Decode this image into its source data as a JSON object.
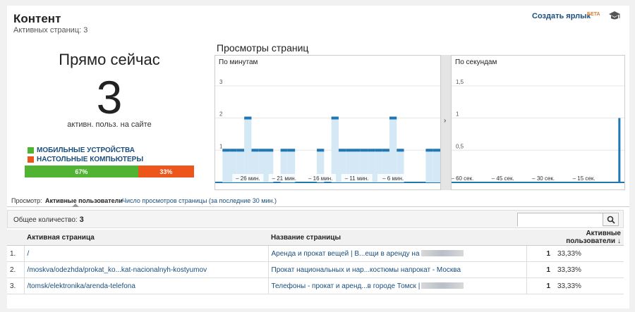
{
  "header": {
    "title": "Контент",
    "subtitle": "Активных страниц: 3",
    "shortcut_label": "Создать ярлык",
    "beta_label": "БЕТА"
  },
  "now": {
    "title": "Прямо сейчас",
    "count": "3",
    "subtitle": "активн. польз. на сайте",
    "legend": [
      {
        "label": "МОБИЛЬНЫЕ УСТРОЙСТВА",
        "color": "#50b432"
      },
      {
        "label": "НАСТОЛЬНЫЕ КОМПЬЮТЕРЫ",
        "color": "#ed561b"
      }
    ],
    "split": [
      {
        "label": "67%",
        "fraction": 0.67,
        "color": "#50b432"
      },
      {
        "label": "33%",
        "fraction": 0.33,
        "color": "#ed561b"
      }
    ]
  },
  "views": {
    "title": "Просмотры страниц",
    "minutes_label": "По минутам",
    "seconds_label": "По секундам",
    "collapse_icon": "chevron-right-icon"
  },
  "chart_data": [
    {
      "type": "bar",
      "title": "По минутам",
      "yticks": [
        1,
        2,
        3
      ],
      "ylim": [
        0,
        3.5
      ],
      "xtick_labels": [
        "– 26 мин.",
        "– 21 мин.",
        "– 16 мин.",
        "– 11 мин.",
        "– 6 мин."
      ],
      "x": [
        -30,
        -29,
        -28,
        -27,
        -26,
        -25,
        -24,
        -23,
        -22,
        -21,
        -20,
        -19,
        -18,
        -17,
        -16,
        -15,
        -14,
        -13,
        -12,
        -11,
        -10,
        -9,
        -8,
        -7,
        -6,
        -5,
        -4,
        -3,
        -2,
        -1,
        0
      ],
      "values": [
        0,
        1,
        1,
        1,
        2,
        1,
        1,
        1,
        0,
        1,
        1,
        0,
        0,
        0,
        1,
        0,
        2,
        1,
        1,
        1,
        1,
        1,
        1,
        1,
        2,
        1,
        0,
        0,
        0,
        1,
        1
      ],
      "grid": true
    },
    {
      "type": "bar",
      "title": "По секундам",
      "yticks": [
        0.5,
        1,
        1.5
      ],
      "ylim": [
        0,
        1.75
      ],
      "xtick_labels": [
        "– 60 сек.",
        "– 45 сек.",
        "– 30 сек.",
        "– 15 сек."
      ],
      "x": [
        -2
      ],
      "values": [
        1
      ],
      "grid": true
    }
  ],
  "tabs": {
    "view_label": "Просмотр:",
    "active": "Активные пользователи",
    "other": "Число просмотров страницы (за последние 30 мин.)"
  },
  "total": {
    "label": "Общее количество:",
    "value": "3",
    "search_placeholder": ""
  },
  "table": {
    "headers": {
      "page": "Активная страница",
      "title": "Название страницы",
      "users": "Активные пользователи"
    },
    "rows": [
      {
        "idx": "1.",
        "page": "/",
        "title": "Аренда и прокат вещей | В...ещи в аренду на",
        "count": "1",
        "pct": "33,33%"
      },
      {
        "idx": "2.",
        "page": "/moskva/odezhda/prokat_ko...kat-nacionalnyh-kostyumov",
        "title": "Прокат национальных и нар...костюмы напрокат - Москва",
        "count": "1",
        "pct": "33,33%"
      },
      {
        "idx": "3.",
        "page": "/tomsk/elektronika/arenda-telefona",
        "title": "Телефоны - прокат и аренд...в городе Томск |",
        "count": "1",
        "pct": "33,33%"
      }
    ]
  }
}
